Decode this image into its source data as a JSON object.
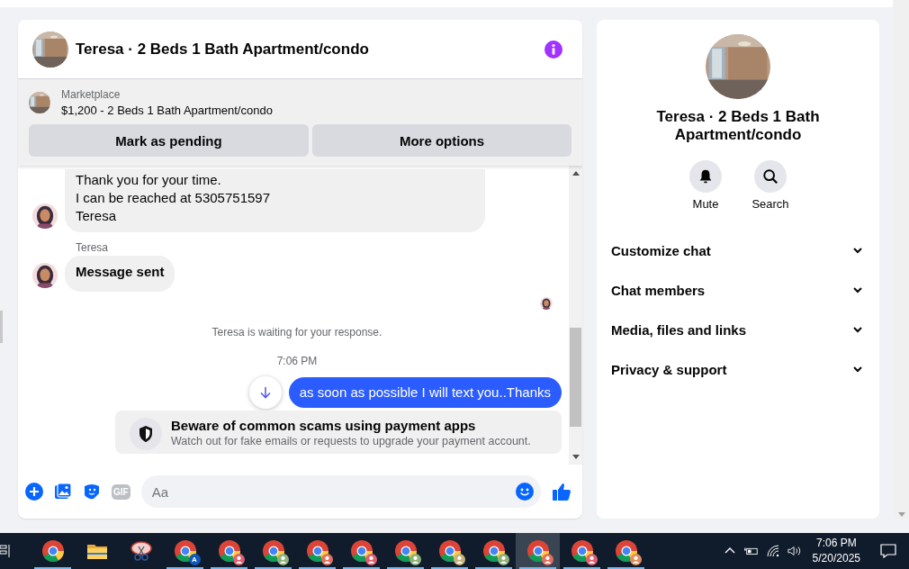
{
  "chat": {
    "title": "Teresa · 2 Beds 1 Bath Apartment/condo",
    "listing": {
      "source": "Marketplace",
      "title": "$1,200 - 2 Beds 1 Bath Apartment/condo",
      "buttons": [
        "Mark as pending",
        "More options"
      ]
    },
    "messages": [
      {
        "kind": "incoming",
        "lines": [
          "Thank you for your time.",
          "I can be reached at 5305751597",
          "Teresa"
        ]
      },
      {
        "kind": "incoming",
        "sender": "Teresa",
        "lines": [
          "Message sent"
        ],
        "bold": true
      },
      {
        "kind": "seen"
      },
      {
        "kind": "status",
        "text": "Teresa is waiting for your response."
      },
      {
        "kind": "time",
        "text": "7:06 PM"
      },
      {
        "kind": "outgoing",
        "text": "as soon as possible I will text you..Thanks"
      },
      {
        "kind": "notice",
        "title": "Beware of common scams using payment apps",
        "body": "Watch out for fake emails or requests to upgrade your payment account."
      }
    ],
    "composer": {
      "placeholder": "Aa",
      "gif_label": "GIF"
    }
  },
  "details": {
    "title": "Teresa · 2 Beds 1 Bath Apartment/condo",
    "actions": [
      {
        "kind": "mute",
        "label": "Mute"
      },
      {
        "kind": "search",
        "label": "Search"
      }
    ],
    "sections": [
      {
        "label": "Customize chat",
        "expanded": false
      },
      {
        "label": "Chat members",
        "expanded": false
      },
      {
        "label": "Media, files and links",
        "expanded": false
      },
      {
        "label": "Privacy & support",
        "expanded": false
      }
    ]
  },
  "taskbar": {
    "apps": [
      {
        "kind": "chrome",
        "running": true,
        "selected": false
      },
      {
        "kind": "folder",
        "running": false,
        "selected": false
      },
      {
        "kind": "snip",
        "running": false,
        "selected": false
      },
      {
        "kind": "chrome",
        "badge": "A",
        "color": "#0f5ab8",
        "running": true,
        "selected": false
      },
      {
        "kind": "chrome",
        "color": "#e06070",
        "running": true,
        "selected": false
      },
      {
        "kind": "chrome",
        "color": "#8fb27a",
        "running": true,
        "selected": false
      },
      {
        "kind": "chrome",
        "color": "#e07060",
        "running": true,
        "selected": false
      },
      {
        "kind": "chrome",
        "color": "#e06070",
        "running": true,
        "selected": false
      },
      {
        "kind": "chrome",
        "color": "#8fb27a",
        "running": true,
        "selected": false
      },
      {
        "kind": "chrome",
        "color": "#c9b27a",
        "running": true,
        "selected": false
      },
      {
        "kind": "chrome",
        "color": "#8fb27a",
        "running": true,
        "selected": false
      },
      {
        "kind": "chrome",
        "color": "#e07060",
        "running": true,
        "selected": true
      },
      {
        "kind": "chrome",
        "color": "#e06070",
        "running": true,
        "selected": false
      },
      {
        "kind": "chrome",
        "color": "#e09060",
        "running": true,
        "selected": false
      }
    ],
    "time": "7:06 PM",
    "date": "5/20/2025"
  }
}
